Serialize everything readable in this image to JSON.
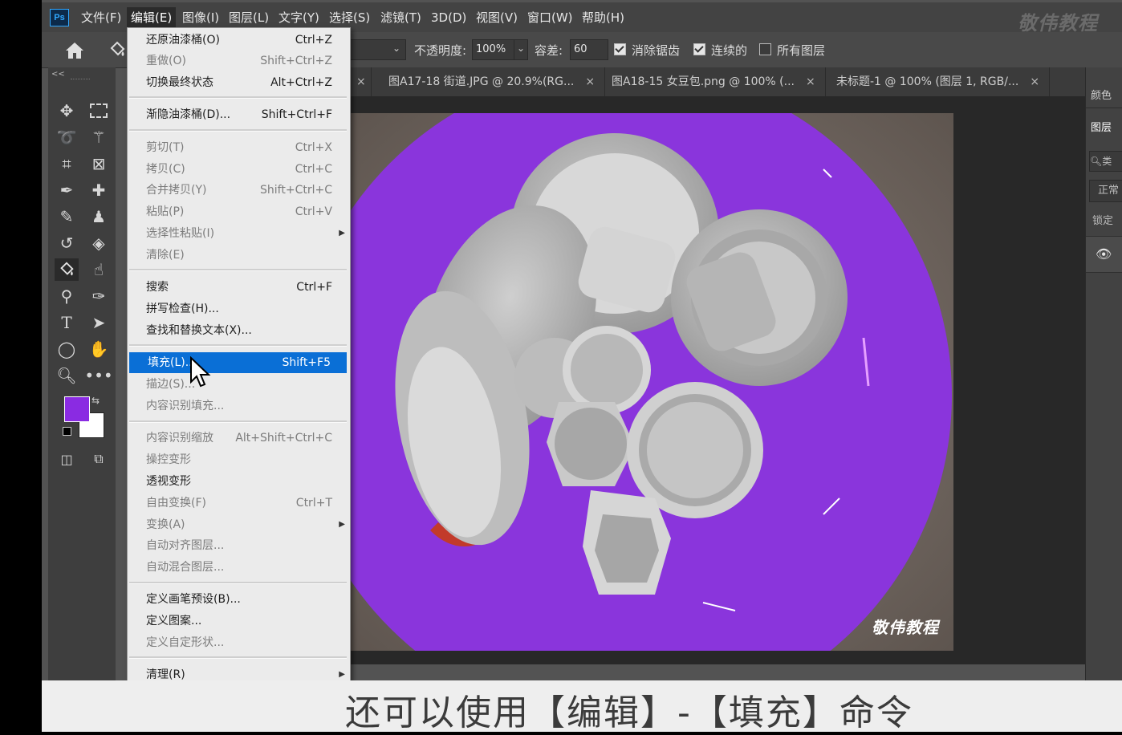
{
  "app": {
    "logo": "Ps",
    "watermark": "敬伟教程"
  },
  "menubar": {
    "items": [
      "文件(F)",
      "编辑(E)",
      "图像(I)",
      "图层(L)",
      "文字(Y)",
      "选择(S)",
      "滤镜(T)",
      "3D(D)",
      "视图(V)",
      "窗口(W)",
      "帮助(H)"
    ],
    "active_index": 1
  },
  "options": {
    "opacity_label": "不透明度:",
    "opacity_value": "100%",
    "tolerance_label": "容差:",
    "tolerance_value": "60",
    "antialias_label": "消除锯齿",
    "antialias_checked": true,
    "contiguous_label": "连续的",
    "contiguous_checked": true,
    "all_layers_label": "所有图层",
    "all_layers_checked": false
  },
  "tabs": [
    {
      "label": "图A17-18 街道.JPG @ 20.9%(RG..."
    },
    {
      "label": "图A18-15 女豆包.png @ 100% (..."
    },
    {
      "label": "未标题-1 @ 100% (图层 1, RGB/..."
    }
  ],
  "toolbar": {
    "collapse_label": "<<",
    "foreground_color": "#8a2be2",
    "background_color": "#ffffff"
  },
  "right_panel": {
    "tabs": [
      "颜色",
      "图层"
    ],
    "search_hint": "类",
    "blend_mode": "正常",
    "lock_label": "锁定"
  },
  "edit_menu": {
    "items": [
      {
        "label": "还原油漆桶(O)",
        "shortcut": "Ctrl+Z",
        "disabled": false
      },
      {
        "label": "重做(O)",
        "shortcut": "Shift+Ctrl+Z",
        "disabled": true
      },
      {
        "label": "切换最终状态",
        "shortcut": "Alt+Ctrl+Z",
        "disabled": false
      },
      {
        "label": "渐隐油漆桶(D)...",
        "shortcut": "Shift+Ctrl+F",
        "disabled": false
      },
      {
        "label": "剪切(T)",
        "shortcut": "Ctrl+X",
        "disabled": true
      },
      {
        "label": "拷贝(C)",
        "shortcut": "Ctrl+C",
        "disabled": true
      },
      {
        "label": "合并拷贝(Y)",
        "shortcut": "Shift+Ctrl+C",
        "disabled": true
      },
      {
        "label": "粘贴(P)",
        "shortcut": "Ctrl+V",
        "disabled": true
      },
      {
        "label": "选择性粘贴(I)",
        "shortcut": "",
        "disabled": true,
        "submenu": true
      },
      {
        "label": "清除(E)",
        "shortcut": "",
        "disabled": true
      },
      {
        "label": "搜索",
        "shortcut": "Ctrl+F",
        "disabled": false
      },
      {
        "label": "拼写检查(H)...",
        "shortcut": "",
        "disabled": false
      },
      {
        "label": "查找和替换文本(X)...",
        "shortcut": "",
        "disabled": false
      },
      {
        "label": "填充(L)...",
        "shortcut": "Shift+F5",
        "disabled": false,
        "highlighted": true
      },
      {
        "label": "描边(S)...",
        "shortcut": "",
        "disabled": true
      },
      {
        "label": "内容识别填充...",
        "shortcut": "",
        "disabled": true
      },
      {
        "label": "内容识别缩放",
        "shortcut": "Alt+Shift+Ctrl+C",
        "disabled": true
      },
      {
        "label": "操控变形",
        "shortcut": "",
        "disabled": true
      },
      {
        "label": "透视变形",
        "shortcut": "",
        "disabled": false
      },
      {
        "label": "自由变换(F)",
        "shortcut": "Ctrl+T",
        "disabled": true
      },
      {
        "label": "变换(A)",
        "shortcut": "",
        "disabled": true,
        "submenu": true
      },
      {
        "label": "自动对齐图层...",
        "shortcut": "",
        "disabled": true
      },
      {
        "label": "自动混合图层...",
        "shortcut": "",
        "disabled": true
      },
      {
        "label": "定义画笔预设(B)...",
        "shortcut": "",
        "disabled": false
      },
      {
        "label": "定义图案...",
        "shortcut": "",
        "disabled": false
      },
      {
        "label": "定义自定形状...",
        "shortcut": "",
        "disabled": true
      },
      {
        "label": "清理(R)",
        "shortcut": "",
        "disabled": false,
        "submenu": true
      }
    ]
  },
  "canvas": {
    "watermark": "敬伟教程",
    "fill_color": "#8a2be2"
  },
  "subtitle": "还可以使用【编辑】-【填充】命令"
}
